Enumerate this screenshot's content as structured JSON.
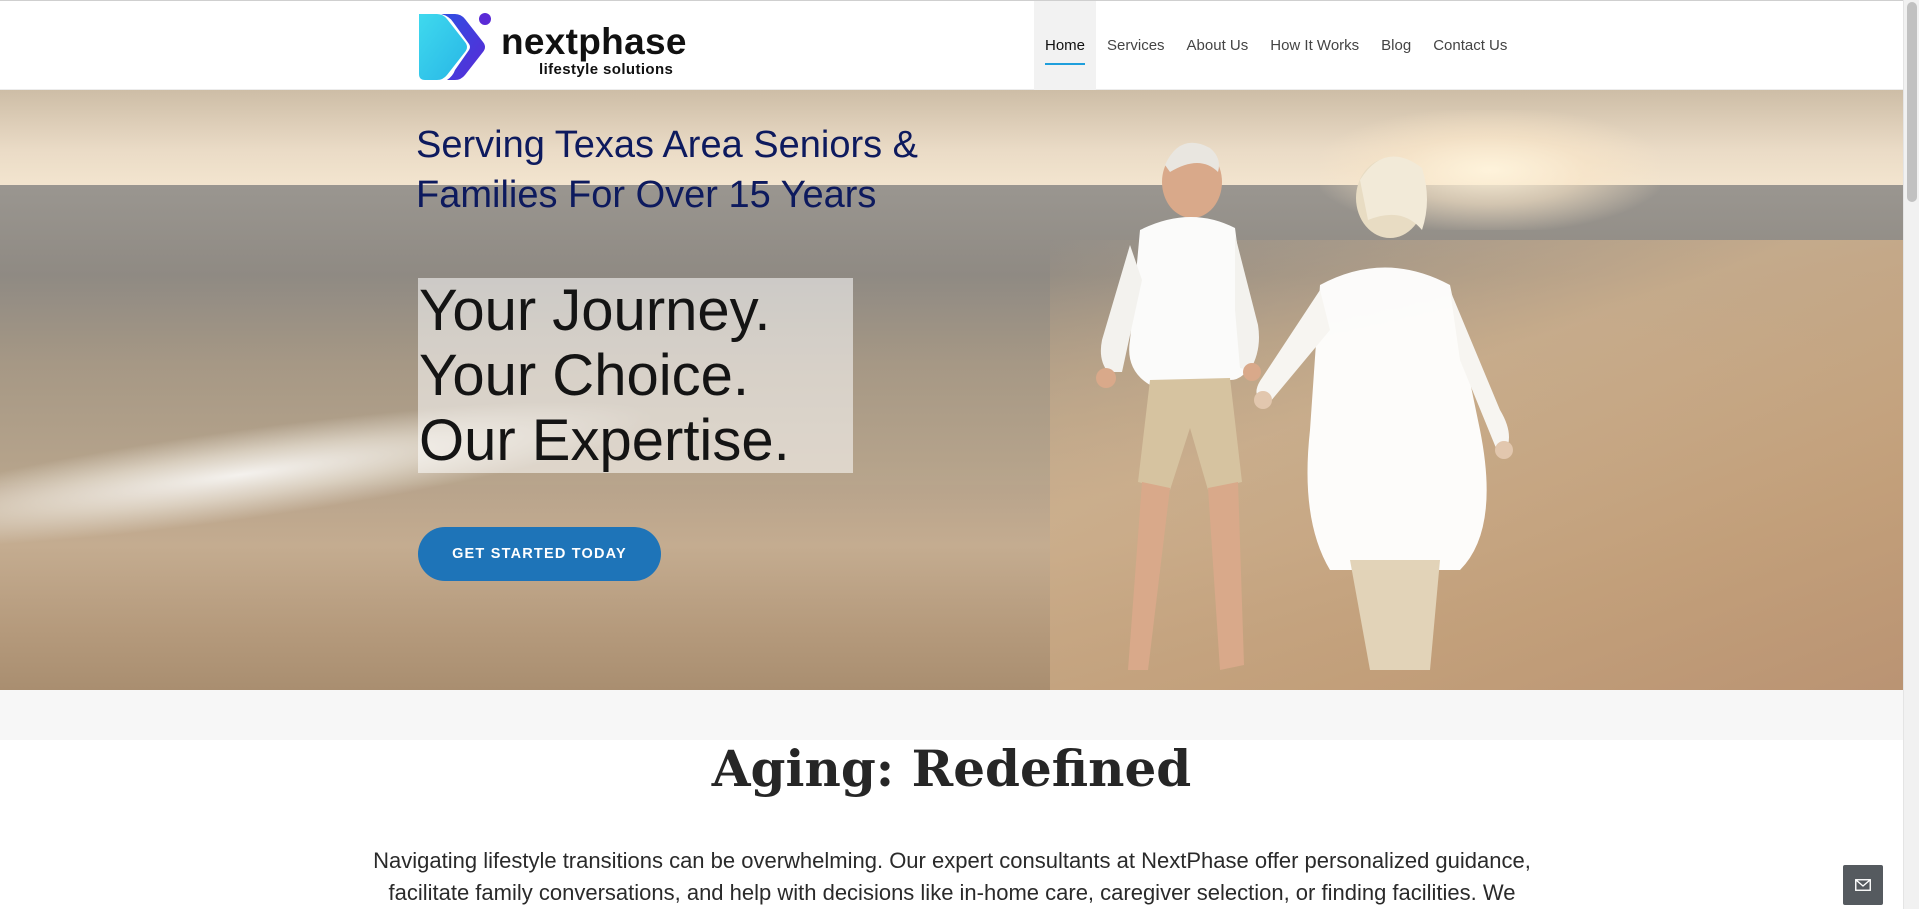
{
  "brand": {
    "name": "nextphase",
    "tagline": "lifestyle solutions",
    "colors": {
      "cyan": "#3ad0ea",
      "blue": "#2d6fe0",
      "purple": "#5a2ad6"
    }
  },
  "nav": {
    "items": [
      {
        "label": "Home",
        "active": true
      },
      {
        "label": "Services",
        "active": false
      },
      {
        "label": "About Us",
        "active": false
      },
      {
        "label": "How It Works",
        "active": false
      },
      {
        "label": "Blog",
        "active": false
      },
      {
        "label": "Contact Us",
        "active": false
      }
    ],
    "active_color": "#1f9fdc"
  },
  "hero": {
    "kicker": "Serving Texas Area Seniors & Families For Over 15 Years",
    "headline": [
      "Your Journey.",
      "Your Choice.",
      "Our Expertise."
    ],
    "cta_label": "GET STARTED TODAY",
    "cta_color": "#1e74b8",
    "image": "couple-walking-on-beach-at-sunset"
  },
  "intro": {
    "title": "Aging: Redefined",
    "text": "Navigating lifestyle transitions can be overwhelming. Our expert consultants at NextPhase offer personalized guidance, facilitate family conversations, and help with decisions like in-home care, caregiver selection, or finding facilities. We"
  },
  "floating_button": {
    "icon": "mail-icon"
  }
}
